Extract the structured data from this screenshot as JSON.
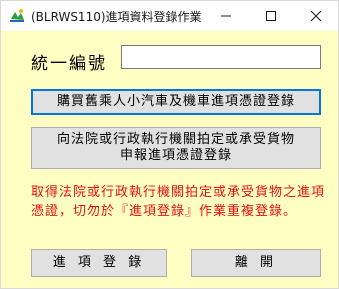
{
  "window": {
    "title": "(BLRWS110)進項資料登錄作業",
    "icon": "app-logo-icon",
    "controls": [
      "minimize-icon",
      "maximize-icon",
      "close-icon"
    ]
  },
  "form": {
    "id_label": "統一編號",
    "id_value": ""
  },
  "buttons": {
    "purchase_used_cars": "購買舊乘人小汽車及機車進項憑證登錄",
    "court_line1": "向法院或行政執行機關拍定或承受貨物",
    "court_line2": "申報進項憑證登錄",
    "register": "進 項 登 錄",
    "leave": "離 開"
  },
  "warning_text": "取得法院或行政執行機關拍定或承受貨物之進項憑證，切勿於『進項登錄』作業重複登錄。",
  "colors": {
    "client_bg": "#ffffc4",
    "warning": "#e81010",
    "focus_border": "#0078d7"
  }
}
